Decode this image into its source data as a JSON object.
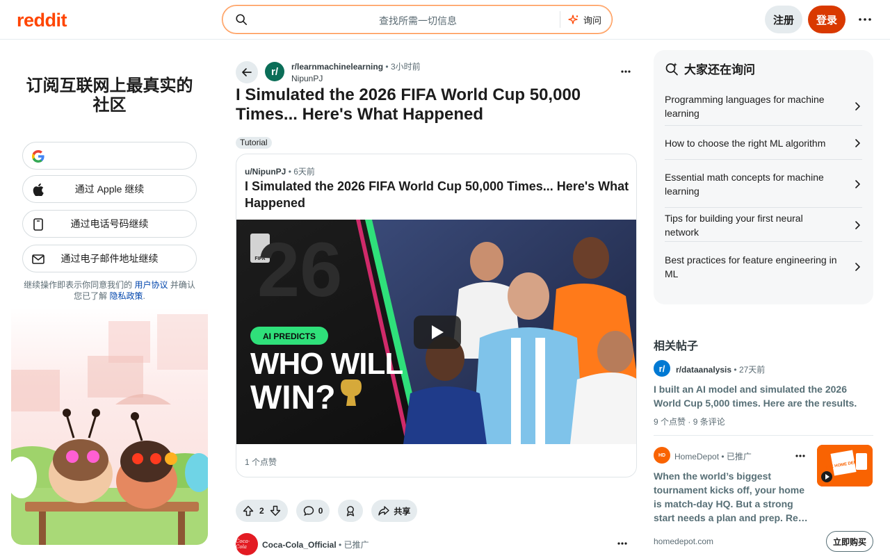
{
  "header": {
    "logo": "reddit",
    "search_placeholder": "查找所需一切信息",
    "ask_label": "询问",
    "register_label": "注册",
    "login_label": "登录",
    "more_icon": "ellipsis-icon"
  },
  "left_panel": {
    "heading": "订阅互联网上最真实的社区",
    "auth_buttons": [
      {
        "label": "",
        "icon": "google-icon"
      },
      {
        "label": "通过 Apple 继续",
        "icon": "apple-icon"
      },
      {
        "label": "通过电话号码继续",
        "icon": "phone-icon"
      },
      {
        "label": "通过电子邮件地址继续",
        "icon": "mail-icon"
      }
    ],
    "legal_prefix": "继续操作即表示你同意我们的",
    "legal_terms": "用户协议",
    "legal_mid": "并确认您已了解",
    "legal_privacy": "隐私政策",
    "legal_end": "."
  },
  "post": {
    "subreddit": "r/learnmachinelearning",
    "time": "3小时前",
    "author": "NipunPJ",
    "title": "I Simulated the 2026 FIFA World Cup 50,000 Times... Here's What Happened",
    "flair": "Tutorial",
    "embed": {
      "author": "u/NipunPJ",
      "time": "6天前",
      "title": "I Simulated the 2026 FIFA World Cup 50,000 Times... Here's What Happened",
      "video_badge": "AI PREDICTS",
      "video_line1": "WHO WILL",
      "video_line2": "WIN?",
      "video_year": "26",
      "video_small": "FIFA",
      "likes": "1 个点赞"
    },
    "votes": "2",
    "comments": "0",
    "share_label": "共享"
  },
  "ad_row": {
    "name": "Coca-Cola_Official",
    "promoted": "已推广",
    "logo_text": "Coca-Cola"
  },
  "right_panel": {
    "heading": "大家还在询问",
    "questions": [
      "Programming languages for machine learning",
      "How to choose the right ML algorithm",
      "Essential math concepts for machine learning",
      "Tips for building your first neural network",
      "Best practices for feature engineering in ML"
    ]
  },
  "related": {
    "heading": "相关帖子",
    "subreddit": "r/dataanalysis",
    "time": "27天前",
    "title": "I built an AI model and simulated the 2026 World Cup 5,000 times. Here are the results.",
    "likes": "9 个点赞",
    "comments": "9 条评论"
  },
  "homedepot_ad": {
    "name": "HomeDepot",
    "promoted": "已推广",
    "text": "When the world’s biggest tournament kicks off, your home is match-day HQ. But a strong start needs a plan and prep. Re…",
    "domain": "homedepot.com",
    "buy_label": "立即购买",
    "thumb_text": "THE HOME DEPOT"
  },
  "colors": {
    "brand": "#ff4500",
    "login": "#d93900",
    "link": "#0045ac"
  }
}
